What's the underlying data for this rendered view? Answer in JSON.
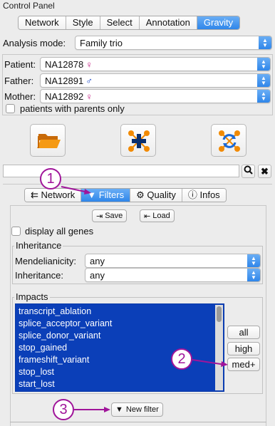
{
  "window": {
    "title": "Control Panel"
  },
  "tabs": [
    {
      "label": "Network",
      "active": false
    },
    {
      "label": "Style",
      "active": false
    },
    {
      "label": "Select",
      "active": false
    },
    {
      "label": "Annotation",
      "active": false
    },
    {
      "label": "Gravity",
      "active": true
    }
  ],
  "analysis": {
    "label": "Analysis mode:",
    "value": "Family trio"
  },
  "family": {
    "patient": {
      "label": "Patient:",
      "value": "NA12878",
      "symbol": "♀"
    },
    "father": {
      "label": "Father:",
      "value": "NA12891",
      "symbol": "♂"
    },
    "mother": {
      "label": "Mother:",
      "value": "NA12892",
      "symbol": "♀"
    },
    "parents_only_label": "patients with parents only"
  },
  "actions": [
    {
      "name": "open-folder-icon"
    },
    {
      "name": "add-network-icon"
    },
    {
      "name": "refresh-network-icon"
    }
  ],
  "search": {
    "value": ""
  },
  "subtabs": [
    {
      "label": "Network",
      "icon": "share-icon",
      "active": false
    },
    {
      "label": "Filters",
      "icon": "filter-icon",
      "active": true
    },
    {
      "label": "Quality",
      "icon": "gear-icon",
      "active": false
    },
    {
      "label": "Infos",
      "icon": "info-icon",
      "active": false
    }
  ],
  "filters": {
    "save_label": "Save",
    "load_label": "Load",
    "display_all_genes_label": "display all genes",
    "inheritance": {
      "legend": "Inheritance",
      "mendelianicity_label": "Mendelianicity:",
      "mendelianicity_value": "any",
      "inheritance_label": "Inheritance:",
      "inheritance_value": "any"
    },
    "impacts": {
      "legend": "Impacts",
      "items": [
        "transcript_ablation",
        "splice_acceptor_variant",
        "splice_donor_variant",
        "stop_gained",
        "frameshift_variant",
        "stop_lost",
        "start_lost"
      ],
      "buttons": {
        "all": "all",
        "high": "high",
        "med": "med+"
      }
    },
    "new_filter_label": "New filter"
  },
  "callouts": [
    "1",
    "2",
    "3"
  ],
  "colors": {
    "accent": "#2f86ea",
    "selection": "#0b3fb8",
    "callout": "#a0159a"
  }
}
